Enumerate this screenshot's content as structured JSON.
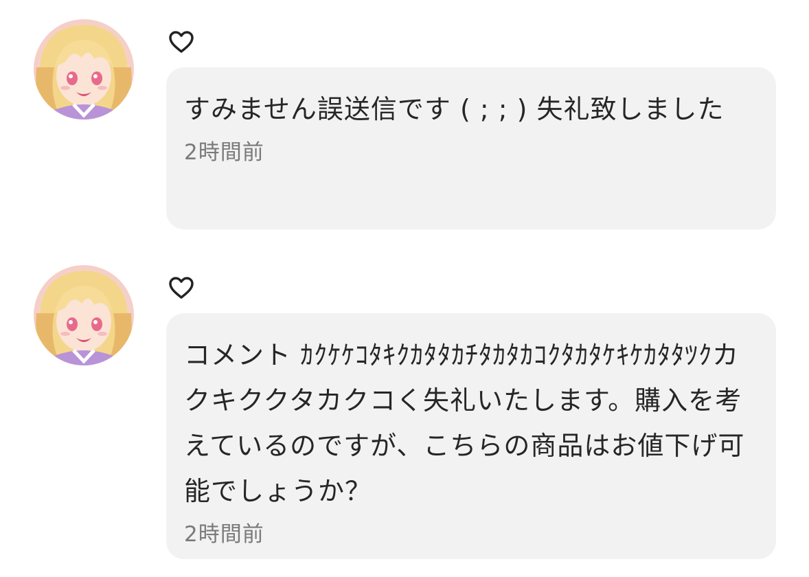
{
  "comments": [
    {
      "avatar_icon": "anime-girl-avatar-icon",
      "like_icon": "heart-outline-icon",
      "text": "すみません誤送信です ( ; ; ) 失礼致しました",
      "time": "2時間前"
    },
    {
      "avatar_icon": "anime-girl-avatar-icon",
      "like_icon": "heart-outline-icon",
      "text": "コメント ｶｸｹｹｺﾀｷｸｶﾀﾀｶﾁﾀｶﾀｶｺｸﾀｶﾀｹｷｹｶﾀﾀﾂｸカクキククタカクコく失礼いたします。購入を考えているのですが、こちらの商品はお値下げ可能でしょうか？",
      "time": "2時間前"
    }
  ],
  "colors": {
    "bubble_bg": "#f2f2f2",
    "text": "#262626",
    "timestamp": "#7a7a7a",
    "heart": "#222222"
  }
}
